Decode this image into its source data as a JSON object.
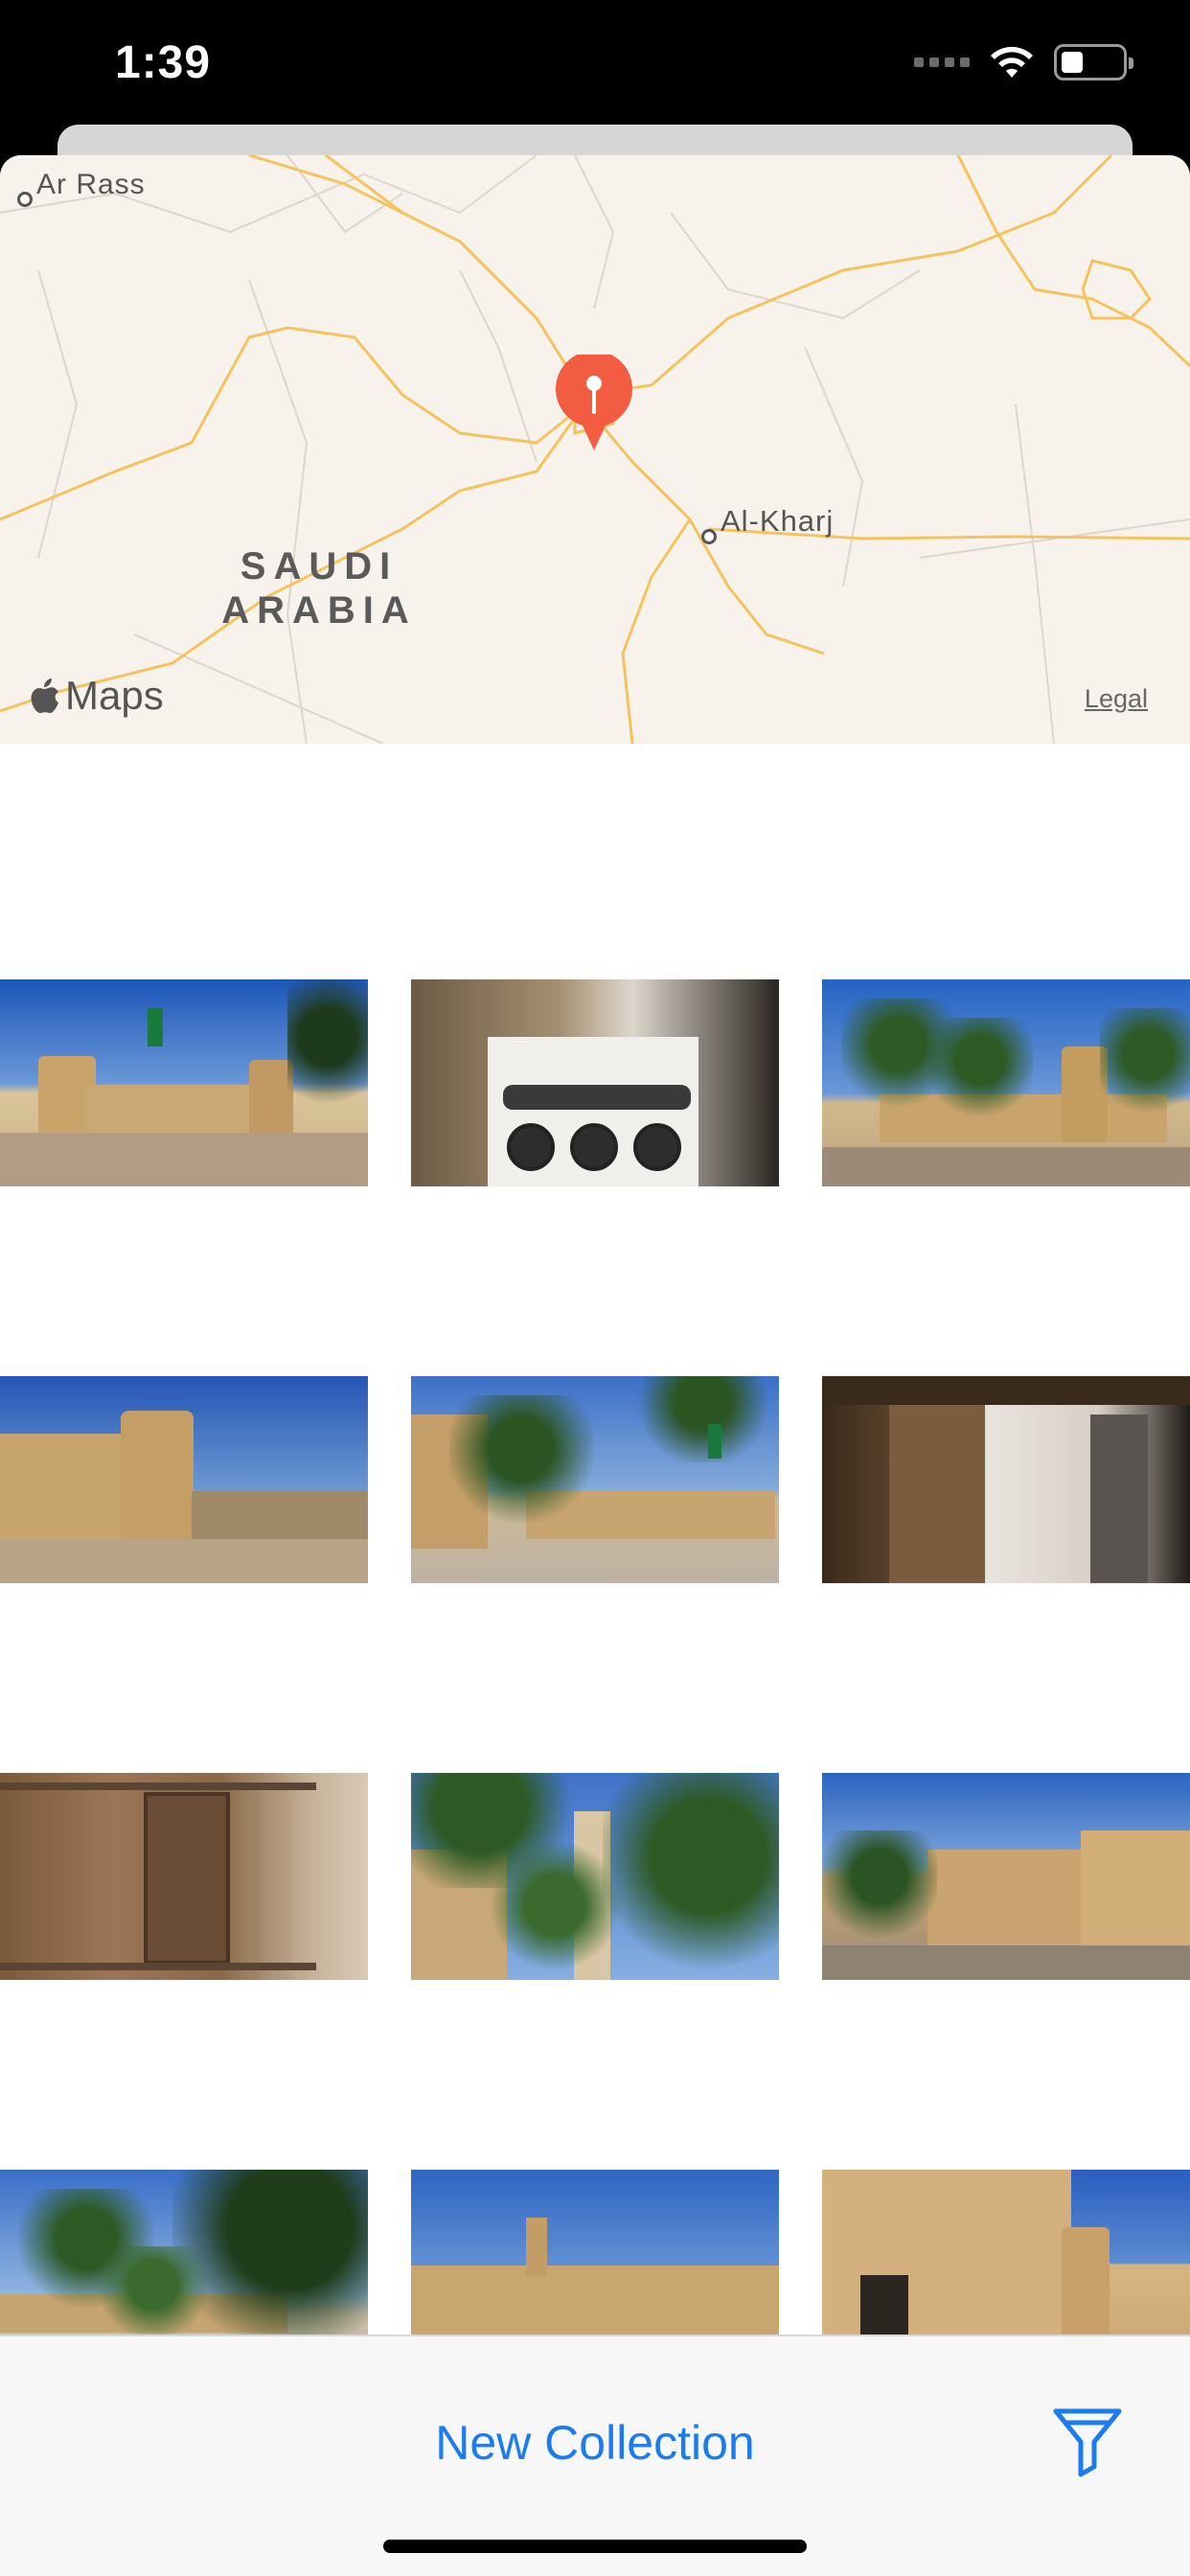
{
  "status_bar": {
    "time": "1:39",
    "battery_level_fraction": 0.35,
    "icons": [
      "cellular-signal-icon",
      "wifi-icon",
      "battery-icon"
    ]
  },
  "map": {
    "places": [
      "Ar Rass",
      "Al-Kharj"
    ],
    "country_label": "SAUDI ARABIA",
    "attribution": "Maps",
    "legal_link": "Legal",
    "pin_icon": "map-pin-icon",
    "colors": {
      "land": "#f7f3ec",
      "roads": "#f5c35e",
      "pin": "#f25c41"
    }
  },
  "photos": [
    {
      "label": "photo-fortress-flag"
    },
    {
      "label": "photo-inscription-plaque"
    },
    {
      "label": "photo-fortress-palms"
    },
    {
      "label": "photo-tower-wall"
    },
    {
      "label": "photo-palm-square-flag"
    },
    {
      "label": "photo-doorway-interior"
    },
    {
      "label": "photo-wooden-door"
    },
    {
      "label": "photo-clocktower-palms"
    },
    {
      "label": "photo-modern-building"
    },
    {
      "label": "photo-palm-plaza"
    },
    {
      "label": "photo-mosque-building"
    },
    {
      "label": "photo-fortress-corner"
    }
  ],
  "toolbar": {
    "new_collection_label": "New Collection",
    "filter_icon": "filter-icon",
    "accent_color": "#1a7cf0"
  }
}
